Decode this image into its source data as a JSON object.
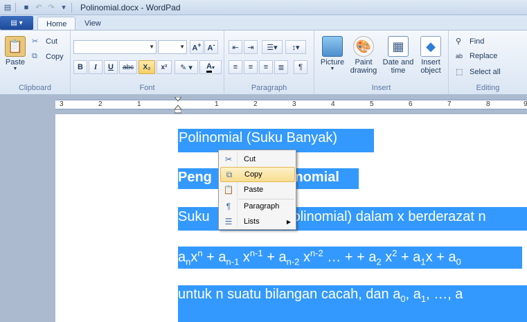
{
  "window": {
    "title": "Polinomial.docx - WordPad"
  },
  "tabs": [
    {
      "label": "Home"
    },
    {
      "label": "View"
    }
  ],
  "clipboard": {
    "group": "Clipboard",
    "paste": "Paste",
    "cut": "Cut",
    "copy": "Copy"
  },
  "font": {
    "group": "Font",
    "name": "",
    "size": "",
    "bold": "B",
    "italic": "I",
    "underline": "U",
    "strike": "abc",
    "subscript": "X₂",
    "superscript": "x²"
  },
  "paragraph": {
    "group": "Paragraph"
  },
  "insert": {
    "group": "Insert",
    "picture": "Picture",
    "paint": [
      "Paint",
      "drawing"
    ],
    "datetime": [
      "Date and",
      "time"
    ],
    "object": [
      "Insert",
      "object"
    ]
  },
  "editing": {
    "group": "Editing",
    "find": "Find",
    "replace": "Replace",
    "selectall": "Select all"
  },
  "ruler": {
    "labels": [
      "3",
      "2",
      "1",
      "1",
      "2",
      "3",
      "4",
      "5",
      "6",
      "7",
      "8",
      "9"
    ]
  },
  "document": {
    "line1": "Polinomial (Suku Banyak)",
    "line2a": "Peng",
    "line2b": "inomial",
    "line3a": "Suku",
    "line3b": "olinomial) dalam x berderazat n",
    "eq": {
      "a": "a",
      "n": "n",
      "x": "x",
      "n1": "n-1",
      "n2": "n-2",
      "plus": " + ",
      "dots": " … + + ",
      "sub2": "2",
      "sup2": "2",
      "sub1": "1",
      "sub0": "0"
    },
    "line5": "untuk n suatu bilangan cacah, dan a",
    "line5b": ", a",
    "line5c": ", …, a"
  },
  "context_menu": [
    {
      "label": "Cut",
      "icon": "scissors-icon"
    },
    {
      "label": "Copy",
      "icon": "copy-icon",
      "highlighted": true
    },
    {
      "label": "Paste",
      "icon": "paste-icon"
    },
    {
      "label": "Paragraph",
      "icon": "paragraph-icon"
    },
    {
      "label": "Lists",
      "icon": "list-icon"
    }
  ],
  "colors": {
    "selection": "#3399ff",
    "ribbon": "#dae5f3",
    "highlight": "#f8dc8e"
  }
}
